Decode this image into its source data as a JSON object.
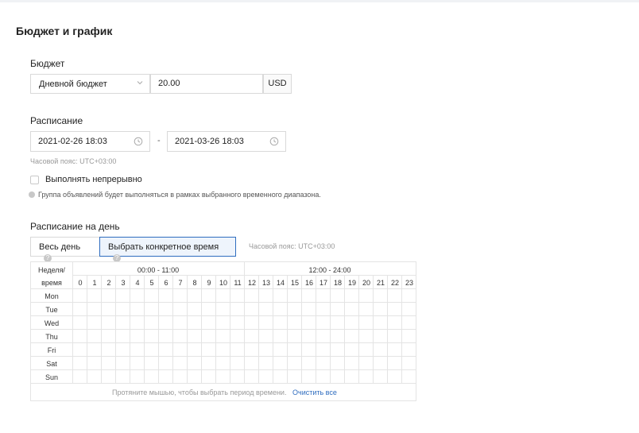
{
  "section_title": "Бюджет и график",
  "budget": {
    "label": "Бюджет",
    "type_selected": "Дневной бюджет",
    "amount": "20.00",
    "currency": "USD"
  },
  "schedule": {
    "label": "Расписание",
    "start": "2021-02-26 18:03",
    "separator": "-",
    "end": "2021-03-26 18:03",
    "timezone": "Часовой пояс: UTC+03:00",
    "continuous_label": "Выполнять непрерывно",
    "continuous_checked": false,
    "note": "Группа объявлений будет выполняться в рамках выбранного временного диапазона."
  },
  "day_schedule": {
    "label": "Расписание на день",
    "tabs": [
      {
        "label": "Весь день",
        "active": false
      },
      {
        "label": "Выбрать конкретное время",
        "active": true
      }
    ],
    "timezone": "Часовой пояс: UTC+03:00",
    "header_week": "Неделя/",
    "header_time": "время",
    "ranges": [
      "00:00 - 11:00",
      "12:00 - 24:00"
    ],
    "hours": [
      "0",
      "1",
      "2",
      "3",
      "4",
      "5",
      "6",
      "7",
      "8",
      "9",
      "10",
      "11",
      "12",
      "13",
      "14",
      "15",
      "16",
      "17",
      "18",
      "19",
      "20",
      "21",
      "22",
      "23"
    ],
    "days": [
      "Mon",
      "Tue",
      "Wed",
      "Thu",
      "Fri",
      "Sat",
      "Sun"
    ],
    "footer_hint": "Протяните мышью, чтобы выбрать период времени.",
    "clear_label": "Очистить все"
  },
  "colors": {
    "accent": "#2f6dbf",
    "border": "#d9d9d9",
    "grid_line": "#e4e4e4"
  }
}
